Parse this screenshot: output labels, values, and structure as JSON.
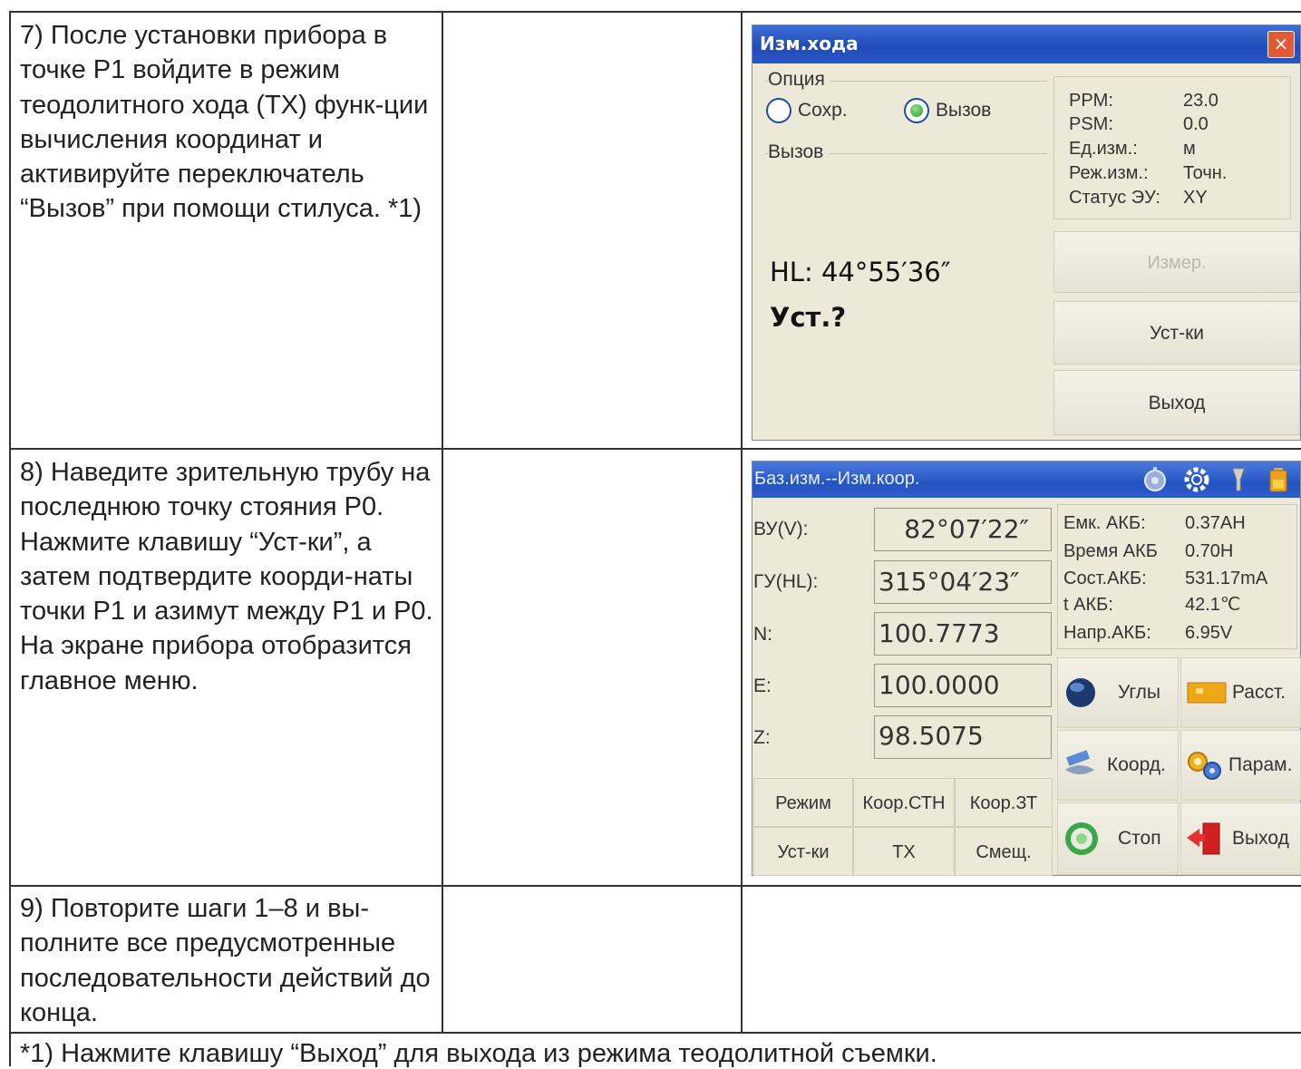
{
  "steps": [
    {
      "number": "7)",
      "text": "7)  После установки прибора в точке P1 войдите в режим теодолитного хода (ТХ) функ-ции вычисления координат и активируйте переключатель “Вызов” при помощи стилуса. *1)"
    },
    {
      "number": "8)",
      "text": "8) Наведите зрительную трубу на последнюю точку стояния P0. Нажмите клавишу “Уст-ки”, а затем подтвердите коорди-наты точки P1 и азимут между P1 и P0. На экране прибора отобразится главное меню."
    },
    {
      "number": "9)",
      "text": "9) Повторите шаги 1–8 и вы-полните все предусмотренные последовательности действий до конца."
    }
  ],
  "footnote": "*1) Нажмите клавишу “Выход” для выхода из режима теодолитной съемки.",
  "screen1": {
    "title": "Изм.хода",
    "close": "×",
    "option_group": "Опция",
    "radio_save": "Сохр.",
    "radio_recall": "Вызов",
    "selected_radio": "Вызов",
    "recall_group": "Вызов",
    "hl_text": "HL:  44°55′36″",
    "prompt": "Уст.?",
    "info": [
      {
        "label": "PPM:",
        "value": "23.0"
      },
      {
        "label": "PSM:",
        "value": "0.0"
      },
      {
        "label": "Ед.изм.:",
        "value": "м"
      },
      {
        "label": "Реж.изм.:",
        "value": "Точн."
      },
      {
        "label": "Статус ЭУ:",
        "value": "XY"
      }
    ],
    "buttons": {
      "measure": "Измер.",
      "settings": "Уст-ки",
      "exit": "Выход"
    }
  },
  "screen2": {
    "title": "Баз.изм.--Изм.коор.",
    "icons": [
      "compass-icon",
      "gear-icon",
      "signal-icon",
      "battery-icon"
    ],
    "fields": [
      {
        "label": "ВУ(V):",
        "value": "82°07′22″"
      },
      {
        "label": "ГУ(HL):",
        "value": "315°04′23″"
      },
      {
        "label": "N:",
        "value": "100.7773"
      },
      {
        "label": "E:",
        "value": "100.0000"
      },
      {
        "label": "Z:",
        "value": "98.5075"
      }
    ],
    "battery": [
      {
        "label": "Емк. АКБ:",
        "value": "0.37AH"
      },
      {
        "label": "Время АКБ",
        "value": "0.70H"
      },
      {
        "label": "Сост.АКБ:",
        "value": "531.17mA"
      },
      {
        "label": "t АКБ:",
        "value": "42.1℃"
      },
      {
        "label": "Напр.АКБ:",
        "value": "6.95V"
      }
    ],
    "softkeys_row1": [
      "Режим",
      "Коор.СТН",
      "Коор.ЗТ"
    ],
    "softkeys_row2": [
      "Уст-ки",
      "ТХ",
      "Смещ."
    ],
    "menu": {
      "angles": "Углы",
      "distance": "Расст.",
      "coords": "Коорд.",
      "params": "Парам.",
      "stop": "Стоп",
      "exit": "Выход"
    }
  }
}
